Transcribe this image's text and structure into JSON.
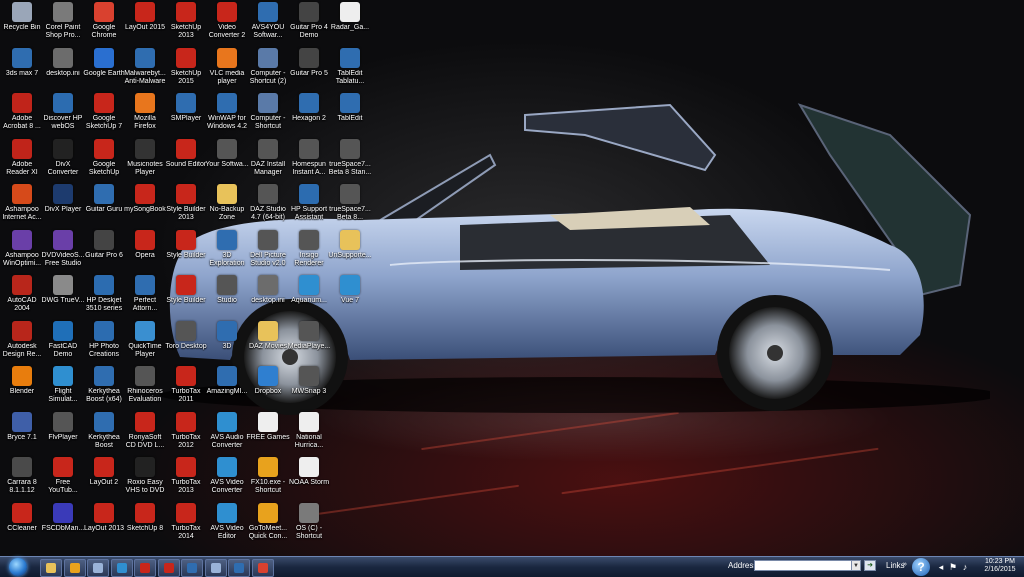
{
  "desktop": {
    "icons": [
      {
        "label": "Recycle Bin",
        "icon": "recycle-bin-icon",
        "color": "#9aa6b8"
      },
      {
        "label": "3ds max 7",
        "icon": "3ds-max-icon",
        "color": "#2f6db0"
      },
      {
        "label": "Adobe Acrobat 8 ...",
        "icon": "acrobat-icon",
        "color": "#c0241a"
      },
      {
        "label": "Adobe Reader XI",
        "icon": "adobe-reader-icon",
        "color": "#c0241a"
      },
      {
        "label": "Ashampoo Internet Ac...",
        "icon": "ashampoo-icon",
        "color": "#d64a1a"
      },
      {
        "label": "Ashampoo WinOptimi...",
        "icon": "ashampoo-icon",
        "color": "#6a3fa8"
      },
      {
        "label": "AutoCAD 2004",
        "icon": "autocad-icon",
        "color": "#b8261b"
      },
      {
        "label": "Autodesk Design Re...",
        "icon": "autodesk-icon",
        "color": "#b8261b"
      },
      {
        "label": "Blender",
        "icon": "blender-icon",
        "color": "#e87d0d"
      },
      {
        "label": "Bryce 7.1",
        "icon": "bryce-icon",
        "color": "#3f5fa8"
      },
      {
        "label": "Carrara 8 8.1.1.12",
        "icon": "carrara-icon",
        "color": "#4a4a4a"
      },
      {
        "label": "CCleaner",
        "icon": "ccleaner-icon",
        "color": "#c8261b"
      },
      {
        "label": "Corel Paint Shop Pro...",
        "icon": "paint-shop-icon",
        "color": "#7a7a7a"
      },
      {
        "label": "desktop.ini",
        "icon": "ini-file-icon",
        "color": "#6c6c6c"
      },
      {
        "label": "Discover HP webOS",
        "icon": "hp-webos-icon",
        "color": "#2c6cb0"
      },
      {
        "label": "DivX Converter",
        "icon": "divx-icon",
        "color": "#222"
      },
      {
        "label": "DivX Player",
        "icon": "divx-icon",
        "color": "#1d3b6e"
      },
      {
        "label": "DVDVideoS... Free Studio",
        "icon": "dvd-studio-icon",
        "color": "#6a3fa8"
      },
      {
        "label": "DWG TrueV...",
        "icon": "dwg-icon",
        "color": "#8a8a8a"
      },
      {
        "label": "FastCAD Demo",
        "icon": "fastcad-icon",
        "color": "#1f6fb8"
      },
      {
        "label": "Flight Simulat...",
        "icon": "flight-sim-icon",
        "color": "#2f8fd0"
      },
      {
        "label": "FlvPlayer",
        "icon": "flv-player-icon",
        "color": "#555"
      },
      {
        "label": "Free YouTub...",
        "icon": "youtube-icon",
        "color": "#c8261b"
      },
      {
        "label": "FSCDbMan...",
        "icon": "fsc-icon",
        "color": "#3a3ab8"
      },
      {
        "label": "Google Chrome",
        "icon": "chrome-icon",
        "color": "#d9412f"
      },
      {
        "label": "Google Earth",
        "icon": "google-earth-icon",
        "color": "#2a6fd0"
      },
      {
        "label": "Google SketchUp 7",
        "icon": "sketchup-icon",
        "color": "#c8261b"
      },
      {
        "label": "Google SketchUp",
        "icon": "sketchup-icon",
        "color": "#c8261b"
      },
      {
        "label": "Guitar Guru",
        "icon": "guitar-guru-icon",
        "color": "#2f6db0"
      },
      {
        "label": "Guitar Pro 6",
        "icon": "guitar-pro-icon",
        "color": "#444"
      },
      {
        "label": "HP Deskjet 3510 series",
        "icon": "printer-icon",
        "color": "#2c6cb0"
      },
      {
        "label": "HP Photo Creations",
        "icon": "hp-photo-icon",
        "color": "#2c6cb0"
      },
      {
        "label": "Kerkythea Boost (x64)",
        "icon": "kerkythea-icon",
        "color": "#2f6db0"
      },
      {
        "label": "Kerkythea Boost",
        "icon": "kerkythea-icon",
        "color": "#2f6db0"
      },
      {
        "label": "LayOut 2",
        "icon": "layout-icon",
        "color": "#c8261b"
      },
      {
        "label": "LayOut 2013",
        "icon": "layout-icon",
        "color": "#c8261b"
      },
      {
        "label": "LayOut 2015",
        "icon": "layout-icon",
        "color": "#c8261b"
      },
      {
        "label": "Malwarebyt... Anti-Malware",
        "icon": "malwarebytes-icon",
        "color": "#2f6db0"
      },
      {
        "label": "Mozilla Firefox",
        "icon": "firefox-icon",
        "color": "#e8761d"
      },
      {
        "label": "Musicnotes Player",
        "icon": "musicnotes-icon",
        "color": "#333"
      },
      {
        "label": "mySongBook",
        "icon": "mysongbook-icon",
        "color": "#c8261b"
      },
      {
        "label": "Opera",
        "icon": "opera-icon",
        "color": "#c8261b"
      },
      {
        "label": "Perfect Attorn...",
        "icon": "app-icon",
        "color": "#2f6db0"
      },
      {
        "label": "QuickTime Player",
        "icon": "quicktime-icon",
        "color": "#3a8fd0"
      },
      {
        "label": "Rhinoceros Evaluation",
        "icon": "rhino-icon",
        "color": "#555"
      },
      {
        "label": "RonyaSoft CD DVD L...",
        "icon": "ronyasoft-icon",
        "color": "#c8261b"
      },
      {
        "label": "Roxio Easy VHS to DVD 3",
        "icon": "roxio-icon",
        "color": "#222"
      },
      {
        "label": "SketchUp 8",
        "icon": "sketchup-icon",
        "color": "#c8261b"
      },
      {
        "label": "SketchUp 2013",
        "icon": "sketchup-icon",
        "color": "#c8261b"
      },
      {
        "label": "SketchUp 2015",
        "icon": "sketchup-icon",
        "color": "#c8261b"
      },
      {
        "label": "SMPlayer",
        "icon": "smplayer-icon",
        "color": "#2f6db0"
      },
      {
        "label": "Sound Editor",
        "icon": "sound-editor-icon",
        "color": "#c8261b"
      },
      {
        "label": "Style Builder 2013",
        "icon": "style-builder-icon",
        "color": "#c8261b"
      },
      {
        "label": "Style Builder",
        "icon": "style-builder-icon",
        "color": "#c8261b"
      },
      {
        "label": "Style Builder",
        "icon": "style-builder-icon",
        "color": "#c8261b"
      },
      {
        "label": "Toro Desktop",
        "icon": "app-icon",
        "color": "#555"
      },
      {
        "label": "TurboTax 2011",
        "icon": "turbotax-icon",
        "color": "#c8261b"
      },
      {
        "label": "TurboTax 2012",
        "icon": "turbotax-icon",
        "color": "#c8261b"
      },
      {
        "label": "TurboTax 2013",
        "icon": "turbotax-icon",
        "color": "#c8261b"
      },
      {
        "label": "TurboTax 2014",
        "icon": "turbotax-icon",
        "color": "#c8261b"
      },
      {
        "label": "Video Converter 2",
        "icon": "video-converter-icon",
        "color": "#c8261b"
      },
      {
        "label": "VLC media player",
        "icon": "vlc-icon",
        "color": "#e8761d"
      },
      {
        "label": "WinWAP for Windows 4.2",
        "icon": "winwap-icon",
        "color": "#2f6db0"
      },
      {
        "label": "Your Softwa...",
        "icon": "app-icon",
        "color": "#555"
      },
      {
        "label": "No-Backup Zone",
        "icon": "folder-icon",
        "color": "#e8c25a"
      },
      {
        "label": "3D Exploration",
        "icon": "3d-icon",
        "color": "#2f6db0"
      },
      {
        "label": "Studio",
        "icon": "app-icon",
        "color": "#555"
      },
      {
        "label": "3D",
        "icon": "3d-icon",
        "color": "#2f6db0"
      },
      {
        "label": "AmazingMI...",
        "icon": "app-icon",
        "color": "#2f6db0"
      },
      {
        "label": "AVS Audio Converter",
        "icon": "avs-audio-icon",
        "color": "#2f8fd0"
      },
      {
        "label": "AVS Video Converter",
        "icon": "avs-video-icon",
        "color": "#2f8fd0"
      },
      {
        "label": "AVS Video Editor",
        "icon": "avs-video-icon",
        "color": "#2f8fd0"
      },
      {
        "label": "AVS4YOU Softwar...",
        "icon": "avs4you-icon",
        "color": "#2f6db0"
      },
      {
        "label": "Computer - Shortcut (2)",
        "icon": "computer-icon",
        "color": "#5a7aa8"
      },
      {
        "label": "Computer - Shortcut",
        "icon": "computer-icon",
        "color": "#5a7aa8"
      },
      {
        "label": "DAZ Install Manager",
        "icon": "daz-icon",
        "color": "#555"
      },
      {
        "label": "DAZ Studio 4.7 (64-bit)",
        "icon": "daz-icon",
        "color": "#555"
      },
      {
        "label": "Dell Picture Studio v2.0",
        "icon": "dell-icon",
        "color": "#555"
      },
      {
        "label": "desktop.ini",
        "icon": "ini-file-icon",
        "color": "#6c6c6c"
      },
      {
        "label": "DAZ Movies",
        "icon": "folder-icon",
        "color": "#e8c25a"
      },
      {
        "label": "Dropbox",
        "icon": "dropbox-icon",
        "color": "#2f7fd0"
      },
      {
        "label": "FREE Games",
        "icon": "games-icon",
        "color": "#eee"
      },
      {
        "label": "FX10.exe - Shortcut",
        "icon": "fx10-icon",
        "color": "#e8a21d"
      },
      {
        "label": "GoToMeet... Quick Con...",
        "icon": "gotomeeting-icon",
        "color": "#e8a21d"
      },
      {
        "label": "Guitar Pro 4 Demo",
        "icon": "guitar-pro-icon",
        "color": "#444"
      },
      {
        "label": "Guitar Pro 5",
        "icon": "guitar-pro-icon",
        "color": "#444"
      },
      {
        "label": "Hexagon 2",
        "icon": "hexagon-icon",
        "color": "#2f6db0"
      },
      {
        "label": "Homespun Instant A...",
        "icon": "homespun-icon",
        "color": "#555"
      },
      {
        "label": "HP Support Assistant",
        "icon": "hp-support-icon",
        "color": "#2c6cb0"
      },
      {
        "label": "Insigo Renderer",
        "icon": "insigo-icon",
        "color": "#555"
      },
      {
        "label": "Aquarium...",
        "icon": "aquarium-icon",
        "color": "#2f8fd0"
      },
      {
        "label": "MediaPlaye...",
        "icon": "media-player-icon",
        "color": "#555"
      },
      {
        "label": "MWSnap 3",
        "icon": "mwsnap-icon",
        "color": "#555"
      },
      {
        "label": "National Hurrica...",
        "icon": "web-shortcut-icon",
        "color": "#eee"
      },
      {
        "label": "NOAA Storm",
        "icon": "web-shortcut-icon",
        "color": "#eee"
      },
      {
        "label": "OS (C) - Shortcut",
        "icon": "drive-icon",
        "color": "#7a7a7a"
      },
      {
        "label": "Radar_Ga...",
        "icon": "radar-icon",
        "color": "#eee"
      },
      {
        "label": "TablEdit Tablatu...",
        "icon": "tabledit-icon",
        "color": "#2f6db0"
      },
      {
        "label": "TablEdit",
        "icon": "tabledit-icon",
        "color": "#2f6db0"
      },
      {
        "label": "trueSpace7... Beta 8 Stan...",
        "icon": "truespace-icon",
        "color": "#555"
      },
      {
        "label": "trueSpace7... Beta 8...",
        "icon": "truespace-icon",
        "color": "#555"
      },
      {
        "label": "UnSupporte...",
        "icon": "folder-icon",
        "color": "#e8c25a"
      },
      {
        "label": "Vue 7",
        "icon": "vue-icon",
        "color": "#2f8fd0"
      }
    ]
  },
  "taskbar": {
    "start_icon": "windows-start-icon",
    "buttons": [
      {
        "icon": "explorer-icon",
        "color": "#e8c25a"
      },
      {
        "icon": "media-icon",
        "color": "#e8a21d"
      },
      {
        "icon": "app-icon",
        "color": "#9ab3d8"
      },
      {
        "icon": "app-icon",
        "color": "#2f8fd0"
      },
      {
        "icon": "opera-icon",
        "color": "#c8261b"
      },
      {
        "icon": "acrobat-icon",
        "color": "#c8261b"
      },
      {
        "icon": "app-icon",
        "color": "#2f6db0"
      },
      {
        "icon": "app-icon",
        "color": "#9ab3d8"
      },
      {
        "icon": "app-icon",
        "color": "#2f6db0"
      },
      {
        "icon": "chrome-icon",
        "color": "#d9412f"
      }
    ],
    "address_label": "Address",
    "address_value": "",
    "links_label": "Links",
    "tray_icons": [
      "network-icon",
      "flag-icon",
      "speaker-icon",
      "power-icon"
    ],
    "clock_time": "10:23 PM",
    "clock_date": "2/16/2015"
  }
}
